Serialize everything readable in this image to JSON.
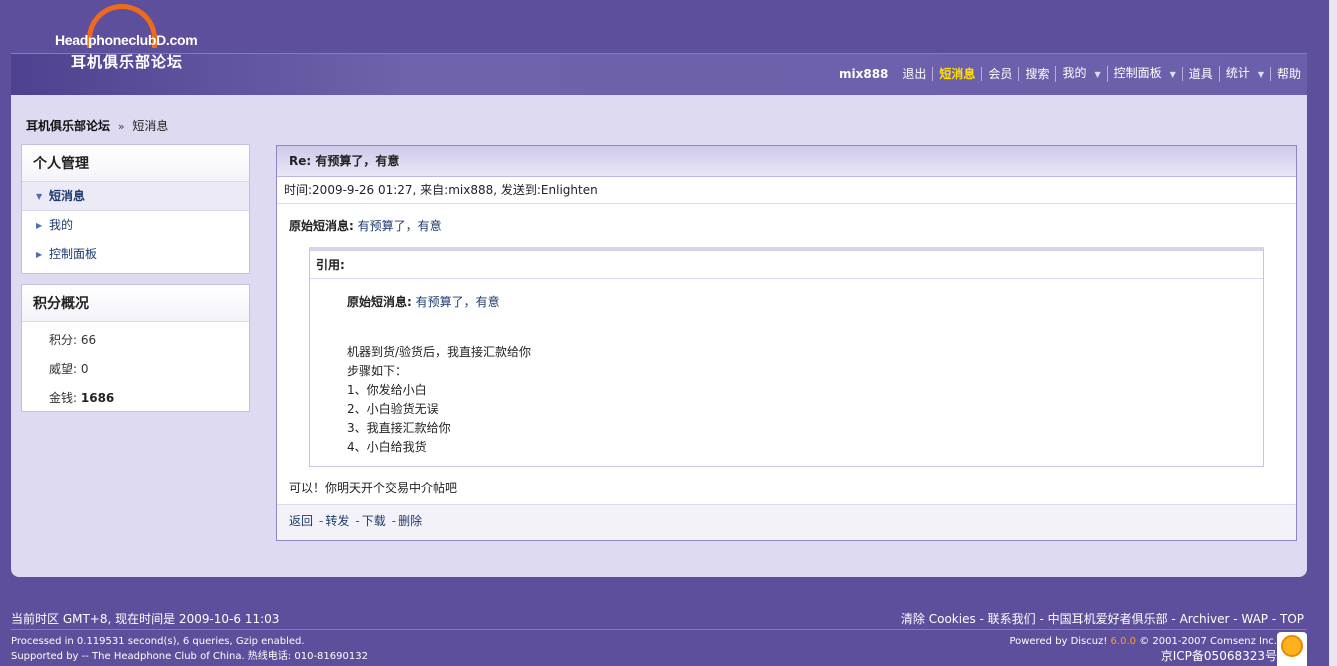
{
  "header": {
    "logo_brand": "HeadphoneclubD.com",
    "logo_cn": "耳机俱乐部论坛",
    "username": "mix888",
    "nav": [
      "退出",
      "短消息",
      "会员",
      "搜索",
      "我的",
      "控制面板",
      "道具",
      "统计",
      "帮助"
    ],
    "active_nav": "短消息"
  },
  "breadcrumb": {
    "home": "耳机俱乐部论坛",
    "sep": "»",
    "current": "短消息"
  },
  "sidebar": {
    "personal_title": "个人管理",
    "items": [
      "短消息",
      "我的",
      "控制面板"
    ],
    "score_title": "积分概况",
    "score": {
      "label": "积分:",
      "value": "66"
    },
    "prestige": {
      "label": "威望:",
      "value": "0"
    },
    "money": {
      "label": "金钱:",
      "value": "1686"
    }
  },
  "message": {
    "title": "Re: 有预算了，有意",
    "meta": "时间:2009-9-26 01:27,  来自:mix888,  发送到:Enlighten",
    "orig_label": "原始短消息:",
    "orig_link": "有预算了，有意",
    "quote_title": "引用:",
    "quote_orig_label": "原始短消息:",
    "quote_orig_link": "有预算了，有意",
    "quote_lines": [
      "机器到货/验货后，我直接汇款给你",
      "步骤如下：",
      "1、你发给小白",
      "2、小白验货无误",
      "3、我直接汇款给你",
      "4、小白给我货"
    ],
    "reply": "可以！你明天开个交易中介帖吧",
    "actions": [
      "返回",
      "转发",
      "下载",
      "删除"
    ]
  },
  "footer": {
    "timezone": "当前时区  GMT+8, 现在时间是  2009-10-6 11:03",
    "links": "清除  Cookies - 联系我们  - 中国耳机爱好者俱乐部  - Archiver - WAP - TOP",
    "processed": "Processed in 0.119531 second(s), 6 queries, Gzip enabled.",
    "supported": "Supported by -- The Headphone Club of China. 热线电话: 010-81690132",
    "powered_pre": "Powered by Discuz!",
    "powered_ver": "6.0.0",
    "powered_post": "© 2001-2007 Comsenz Inc.",
    "icp": "京ICP备05068323号"
  }
}
